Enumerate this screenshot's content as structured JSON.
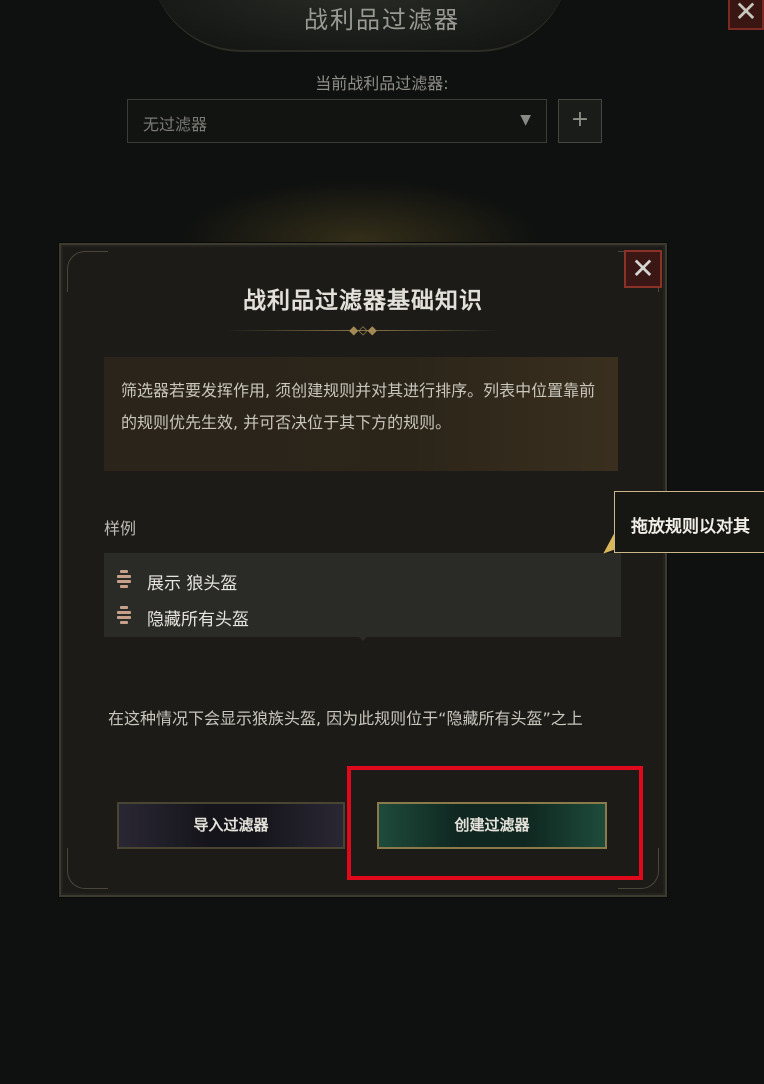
{
  "window": {
    "title": "战利品过滤器",
    "close_glyph": "✕"
  },
  "filter_selector": {
    "label": "当前战利品过滤器:",
    "selected_value": "无过滤器",
    "arrow_glyph": "▼",
    "add_glyph": "+"
  },
  "dialog": {
    "title": "战利品过滤器基础知识",
    "close_glyph": "✕",
    "description": "筛选器若要发挥作用, 须创建规则并对其进行排序。列表中位置靠前的规则优先生效, 并可否决位于其下方的规则。",
    "example_label": "样例",
    "rules": [
      {
        "label": "展示 狼头盔"
      },
      {
        "label": "隐藏所有头盔"
      }
    ],
    "info_text": "在这种情况下会显示狼族头盔, 因为此规则位于“隐藏所有头盔”之上",
    "buttons": {
      "import": "导入过滤器",
      "create": "创建过滤器"
    }
  },
  "tooltip": {
    "text": "拖放规则以对其"
  },
  "colors": {
    "highlight": "#e0081b",
    "create_button": "#0f2720",
    "close_button": "#3a1714"
  }
}
